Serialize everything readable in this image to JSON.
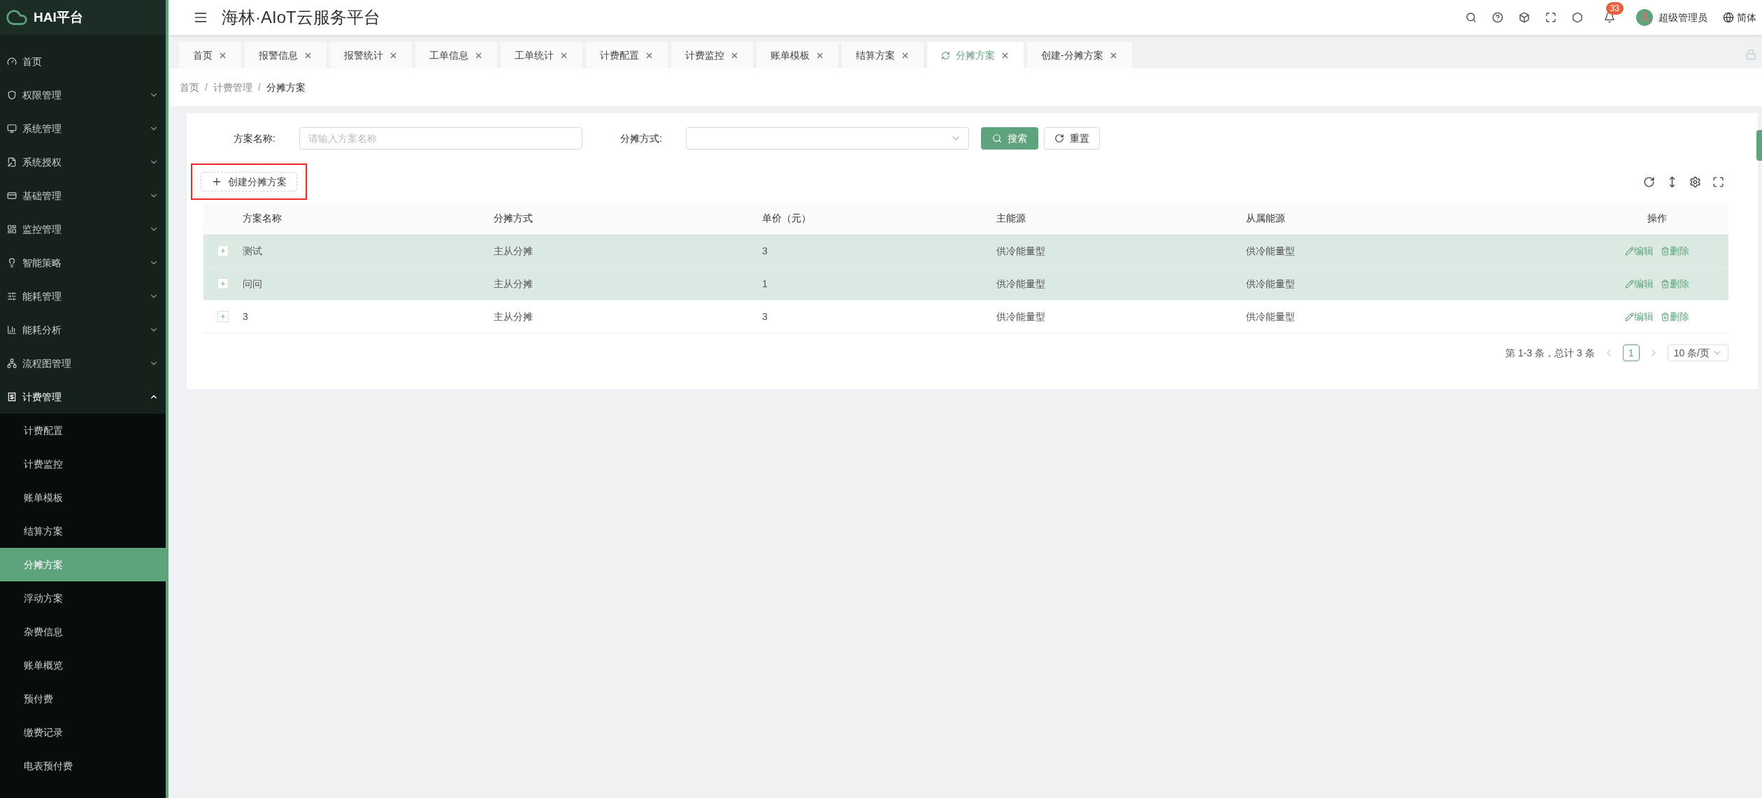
{
  "brand": {
    "name": "HAI平台"
  },
  "sidebar": {
    "items": [
      {
        "kind": "link",
        "label": "首页"
      },
      {
        "kind": "group",
        "label": "权限管理",
        "expanded": false
      },
      {
        "kind": "group",
        "label": "系统管理",
        "expanded": false
      },
      {
        "kind": "group",
        "label": "系统授权",
        "expanded": false
      },
      {
        "kind": "group",
        "label": "基础管理",
        "expanded": false
      },
      {
        "kind": "group",
        "label": "监控管理",
        "expanded": false
      },
      {
        "kind": "group",
        "label": "智能策略",
        "expanded": false
      },
      {
        "kind": "group",
        "label": "能耗管理",
        "expanded": false
      },
      {
        "kind": "group",
        "label": "能耗分析",
        "expanded": false
      },
      {
        "kind": "group",
        "label": "流程图管理",
        "expanded": false
      },
      {
        "kind": "group",
        "label": "计费管理",
        "expanded": true,
        "children": [
          {
            "label": "计费配置",
            "selected": false
          },
          {
            "label": "计费监控",
            "selected": false
          },
          {
            "label": "账单模板",
            "selected": false
          },
          {
            "label": "结算方案",
            "selected": false
          },
          {
            "label": "分摊方案",
            "selected": true
          },
          {
            "label": "浮动方案",
            "selected": false
          },
          {
            "label": "杂费信息",
            "selected": false
          },
          {
            "label": "账单概览",
            "selected": false
          },
          {
            "label": "预付费",
            "selected": false
          },
          {
            "label": "缴费记录",
            "selected": false
          },
          {
            "label": "电表预付费",
            "selected": false
          }
        ]
      }
    ]
  },
  "header": {
    "title": "海林·AIoT云服务平台",
    "notifications": "33",
    "user": "超级管理员",
    "language": "简体"
  },
  "tabs": [
    {
      "label": "首页",
      "selected": false
    },
    {
      "label": "报警信息",
      "selected": false
    },
    {
      "label": "报警统计",
      "selected": false
    },
    {
      "label": "工单信息",
      "selected": false
    },
    {
      "label": "工单统计",
      "selected": false
    },
    {
      "label": "计费配置",
      "selected": false
    },
    {
      "label": "计费监控",
      "selected": false
    },
    {
      "label": "账单模板",
      "selected": false
    },
    {
      "label": "结算方案",
      "selected": false
    },
    {
      "label": "分摊方案",
      "selected": true
    },
    {
      "label": "创建-分摊方案",
      "selected": false
    }
  ],
  "breadcrumb": {
    "separator": "/",
    "items": [
      "首页",
      "计费管理",
      "分摊方案"
    ]
  },
  "search_form": {
    "name_label": "方案名称:",
    "name_placeholder": "请输入方案名称",
    "method_label": "分摊方式:",
    "search_button": "搜索",
    "reset_button": "重置"
  },
  "create_button": "创建分摊方案",
  "table": {
    "columns": [
      "方案名称",
      "分摊方式",
      "单价（元）",
      "主能源",
      "从属能源",
      "操作"
    ],
    "rows": [
      {
        "highlighted": true,
        "cells": [
          "测试",
          "主从分摊",
          "3",
          "供冷能量型",
          "供冷能量型"
        ],
        "actions": [
          "编辑",
          "删除"
        ]
      },
      {
        "highlighted": true,
        "cells": [
          "问问",
          "主从分摊",
          "1",
          "供冷能量型",
          "供冷能量型"
        ],
        "actions": [
          "编辑",
          "删除"
        ]
      },
      {
        "highlighted": false,
        "cells": [
          "3",
          "主从分摊",
          "3",
          "供冷能量型",
          "供冷能量型"
        ],
        "actions": [
          "编辑",
          "删除"
        ]
      }
    ]
  },
  "pagination": {
    "summary": "第 1-3 条，总计 3 条",
    "pages": [
      {
        "label": "1",
        "selected": true
      }
    ],
    "page_size": "10 条/页"
  }
}
